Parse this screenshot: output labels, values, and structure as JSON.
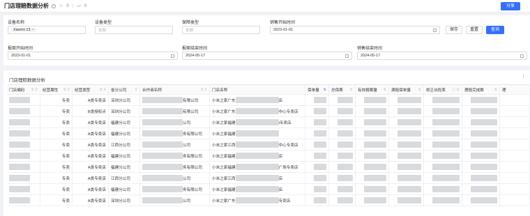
{
  "header": {
    "title": "门店理赔数据分析",
    "star_count": "0",
    "comment_count": "0",
    "share_label": "分享"
  },
  "filters": {
    "device_name": {
      "label": "设备名称",
      "tag": "Xiaomi 13"
    },
    "device_type": {
      "label": "设备类型",
      "placeholder": "全部"
    },
    "warranty_type": {
      "label": "保障类型",
      "placeholder": "全部"
    },
    "sale_start": {
      "label": "销售开始时间",
      "value": "2023-01-01"
    },
    "report_start": {
      "label": "报案开始时间",
      "value": "2023-01-01"
    },
    "report_end": {
      "label": "报案结束时间",
      "value": "2024-05-17"
    },
    "sale_end": {
      "label": "销售结束时间",
      "value": "2024-05-17"
    },
    "save_label": "保存",
    "reset_label": "重置",
    "query_label": "查询"
  },
  "table": {
    "title": "门店理赔数据分析",
    "columns": [
      "门店编码",
      "经营属性",
      "经营类型",
      "省分公司",
      "合作商名称",
      "门店名称",
      "保单量",
      "总保费",
      "有效报案量",
      "满赔保单量",
      "修正出险率",
      "理赔完成数",
      "理"
    ],
    "rows": [
      {
        "attr": "专卖",
        "type": "A类专卖店",
        "branch": "深圳分公司",
        "partner": "有限公司",
        "store": "小米之家广东",
        "store_suffix": "店"
      },
      {
        "attr": "专卖",
        "type": "B类授权点",
        "branch": "深圳分公司",
        "partner": "有限公司",
        "store": "小米之家广东",
        "store_suffix": "中心专卖店"
      },
      {
        "attr": "专卖",
        "type": "A类专卖店",
        "branch": "福建分公司",
        "partner": "公司",
        "store": "小米之家福建",
        "store_suffix": "i专卖店"
      },
      {
        "attr": "专卖",
        "type": "A类专卖店",
        "branch": "福建分公司",
        "partner": "务有限公司",
        "store": "小米之家福建",
        "store_suffix": ""
      },
      {
        "attr": "专卖",
        "type": "A类专卖店",
        "branch": "江西分公司",
        "partner": "公司",
        "store": "小米之家江西",
        "store_suffix": "中心专卖店"
      },
      {
        "attr": "专卖",
        "type": "A类专卖店",
        "branch": "福建分公司",
        "partner": "务有限公司",
        "store": "小米之家福建",
        "store_suffix": "店"
      },
      {
        "attr": "专卖",
        "type": "A类专卖店",
        "branch": "福建分公司",
        "partner": "务有限公司",
        "store": "小米之家福建",
        "store_suffix": "广场专卖店"
      },
      {
        "attr": "专卖",
        "type": "A类专卖店",
        "branch": "江西分公司",
        "partner": "公司",
        "store": "小米之家江西",
        "store_suffix": "店"
      },
      {
        "attr": "专卖",
        "type": "A类专卖店",
        "branch": "福建分公司",
        "partner": "务有限公司",
        "store": "小米之家福建",
        "store_suffix": "店"
      },
      {
        "attr": "专卖",
        "type": "A类专卖店",
        "branch": "深圳分公司",
        "partner": "公司",
        "store": "小米之家广东",
        "store_suffix": "专卖店"
      }
    ]
  },
  "colors": {
    "accent": "#3370ff",
    "redacted": "#d9dadd"
  }
}
